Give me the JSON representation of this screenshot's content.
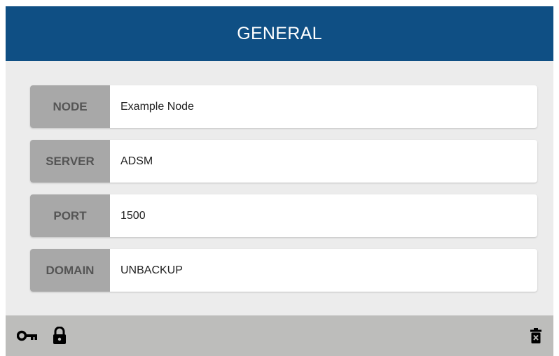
{
  "header": {
    "title": "GENERAL"
  },
  "fields": [
    {
      "label": "NODE",
      "value": "Example Node"
    },
    {
      "label": "SERVER",
      "value": "ADSM"
    },
    {
      "label": "PORT",
      "value": "1500"
    },
    {
      "label": "DOMAIN",
      "value": "UNBACKUP"
    }
  ],
  "footer": {
    "left_icons": [
      "key-icon",
      "lock-icon"
    ],
    "right_icons": [
      "trash-icon"
    ]
  },
  "colors": {
    "header_bg": "#0f4f84",
    "label_bg": "#a8a8a8",
    "panel_bg": "#ececec",
    "footer_bg": "#bdbdbb"
  }
}
